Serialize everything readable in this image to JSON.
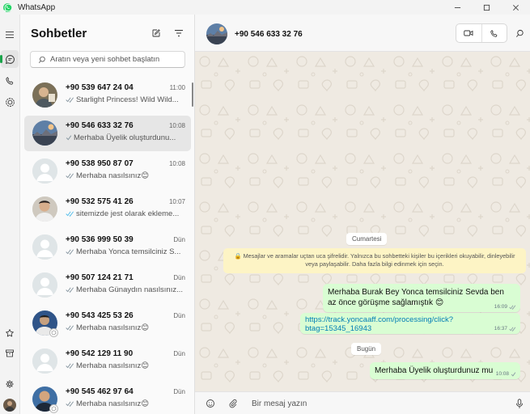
{
  "window": {
    "title": "WhatsApp"
  },
  "sidebar": {
    "title": "Sohbetler"
  },
  "search": {
    "placeholder": "Aratın veya yeni sohbet başlatın"
  },
  "chats": [
    {
      "name": "+90 539 647 24 04",
      "time": "11:00",
      "preview": "Starlight Princess! Wild Wild...",
      "ticks": "double-gray",
      "avatar": "photo"
    },
    {
      "name": "+90 546 633 32 76",
      "time": "10:08",
      "preview": "Merhaba Üyelik oluşturdunu...",
      "ticks": "single-gray",
      "avatar": "photo",
      "selected": true
    },
    {
      "name": "+90 538 950 87 07",
      "time": "10:08",
      "preview": "Merhaba nasılsınız😊",
      "ticks": "double-gray",
      "avatar": "placeholder"
    },
    {
      "name": "+90 532 575 41 26",
      "time": "10:07",
      "preview": "sitemizde jest olarak ekleme...",
      "ticks": "double-blue",
      "avatar": "photo"
    },
    {
      "name": "+90 536 999 50 39",
      "time": "Dün",
      "preview": "Merhaba Yonca temsilciniz S...",
      "ticks": "double-gray",
      "avatar": "placeholder"
    },
    {
      "name": "+90 507 124 21 71",
      "time": "Dün",
      "preview": "Merhaba Günaydın nasılsınız...",
      "ticks": "double-gray",
      "avatar": "placeholder"
    },
    {
      "name": "+90 543 425 53 26",
      "time": "Dün",
      "preview": "Merhaba nasılsınız😊",
      "ticks": "double-gray",
      "avatar": "photo",
      "status": true
    },
    {
      "name": "+90 542 129 11 90",
      "time": "Dün",
      "preview": "Merhaba nasılsınız😊",
      "ticks": "double-gray",
      "avatar": "placeholder"
    },
    {
      "name": "+90 545 462 97 64",
      "time": "Dün",
      "preview": "Merhaba nasılsınız😊",
      "ticks": "double-gray",
      "avatar": "photo",
      "status": true
    }
  ],
  "conversation": {
    "contact": "+90 546 633 32 76",
    "date_1": "Cumartesi",
    "notice": "🔒 Mesajlar ve aramalar uçtan uca şifrelidir. Yalnızca bu sohbetteki kişiler bu içerikleri okuyabilir, dinleyebilir veya paylaşabilir. Daha fazla bilgi edinmek için seçin.",
    "messages": [
      {
        "text": "Merhaba Burak Bey Yonca temsilciniz Sevda ben az önce görüşme sağlamıştık 😊",
        "time": "16:09"
      },
      {
        "text": "https://track.yoncaaff.com/processing/click?btag=15345_16943",
        "time": "16:37",
        "link": true
      }
    ],
    "date_2": "Bugün",
    "last_message": {
      "text": "Merhaba Üyelik oluşturdunuz mu",
      "time": "10:08"
    }
  },
  "composer": {
    "placeholder": "Bir mesaj yazın"
  },
  "icons": {
    "menu": "hamburger-icon",
    "chats": "chat-bubble-icon",
    "calls": "phone-icon",
    "status": "status-ring-icon",
    "starred": "star-icon",
    "archived": "archive-icon",
    "settings": "gear-icon",
    "new_chat": "compose-icon",
    "filter": "filter-icon",
    "video": "video-camera-icon",
    "call": "phone-icon",
    "search": "search-icon",
    "emoji": "emoji-icon",
    "attach": "paperclip-icon",
    "mic": "microphone-icon"
  },
  "colors": {
    "accent": "#1aa34a",
    "bubble_out": "#d9fdd3",
    "chat_bg": "#efeae2",
    "notice_bg": "#fdf4c5",
    "link": "#027eb5",
    "read_tick": "#53bdeb"
  }
}
